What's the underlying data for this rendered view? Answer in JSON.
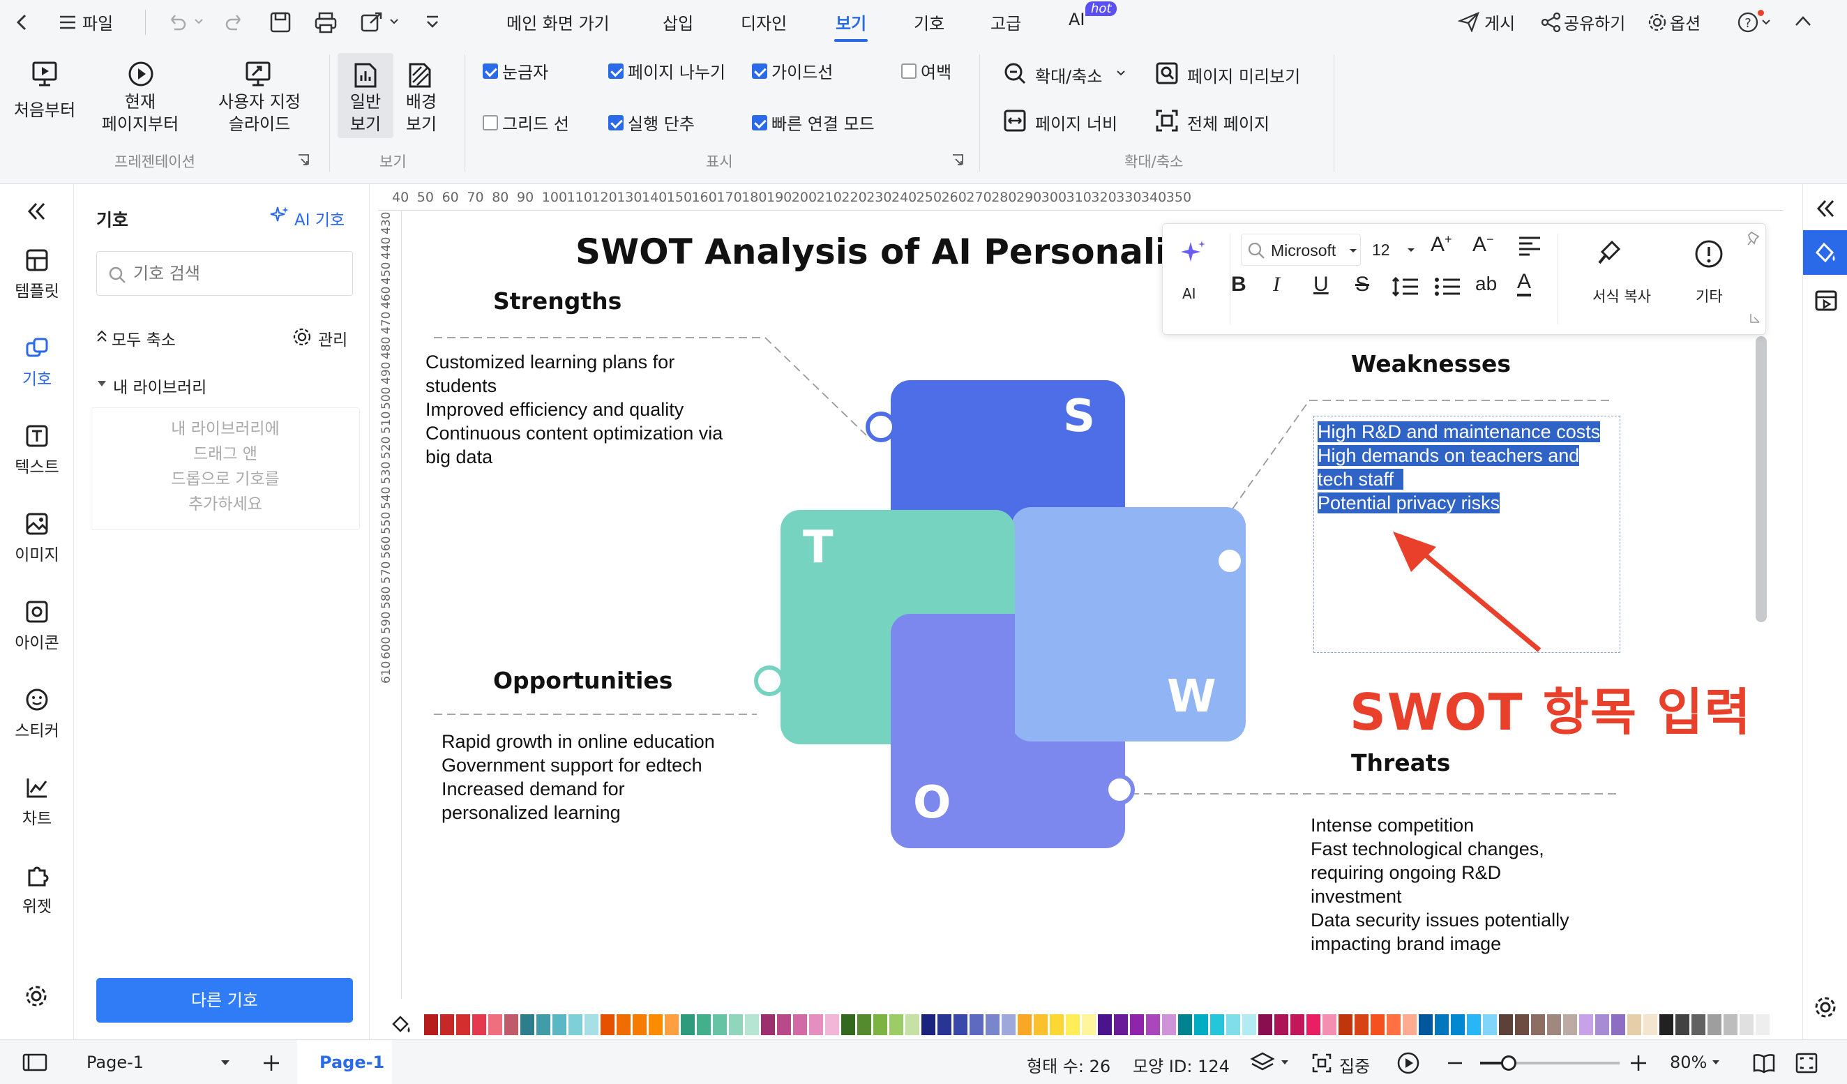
{
  "menubar": {
    "file": "파일",
    "tabs": [
      "메인 화면 가기",
      "삽입",
      "디자인",
      "보기",
      "기호",
      "고급",
      "AI"
    ],
    "active_tab": "보기",
    "ai_badge": "hot",
    "publish": "게시",
    "share": "공유하기",
    "options": "옵션"
  },
  "ribbon": {
    "presentation": {
      "from_start": "처음부터",
      "from_current_1": "현재",
      "from_current_2": "페이지부터",
      "custom_1": "사용자 지정",
      "custom_2": "슬라이드",
      "group_label": "프레젠테이션"
    },
    "view": {
      "normal_1": "일반",
      "normal_2": "보기",
      "background_1": "배경",
      "background_2": "보기",
      "group_label": "보기"
    },
    "display": {
      "ruler": "눈금자",
      "page_break": "페이지 나누기",
      "guides": "가이드선",
      "margin": "여백",
      "grid": "그리드 선",
      "undo": "실행 단추",
      "quick_connect": "빠른 연결 모드",
      "group_label": "표시"
    },
    "zoom": {
      "zoom": "확대/축소",
      "page_preview": "페이지 미리보기",
      "page_width": "페이지 너비",
      "whole_page": "전체 페이지",
      "group_label": "확대/축소"
    }
  },
  "rail": {
    "items": [
      "템플릿",
      "기호",
      "텍스트",
      "이미지",
      "아이콘",
      "스티커",
      "차트",
      "위젯"
    ]
  },
  "panel": {
    "title": "기호",
    "ai_symbols": "AI 기호",
    "search_placeholder": "기호 검색",
    "collapse_all": "모두 축소",
    "manage": "관리",
    "my_library": "내 라이브러리",
    "drop_hint_1": "내 라이브러리에",
    "drop_hint_2": "드래그 앤",
    "drop_hint_3": "드롭으로 기호를",
    "drop_hint_4": "추가하세요",
    "more_symbols": "다른 기호"
  },
  "ruler": {
    "top_ticks": [
      "40",
      "50",
      "60",
      "70",
      "80",
      "90",
      "100",
      "110",
      "120",
      "130",
      "140",
      "150",
      "160",
      "170",
      "180",
      "190",
      "200",
      "210",
      "220",
      "230",
      "240",
      "250",
      "260",
      "270",
      "280",
      "290",
      "300",
      "310",
      "320",
      "330",
      "340",
      "350"
    ],
    "left_ticks": [
      "430",
      "440",
      "450",
      "460",
      "470",
      "480",
      "490",
      "500",
      "510",
      "520",
      "530",
      "540",
      "550",
      "560",
      "570",
      "580",
      "590",
      "600",
      "610"
    ]
  },
  "float_toolbar": {
    "ai": "AI",
    "font": "Microsoft",
    "size": "12",
    "format_painter": "서식 복사",
    "more": "기타"
  },
  "diagram": {
    "title": "SWOT Analysis of AI Personalized",
    "letters": {
      "s": "S",
      "w": "W",
      "o": "O",
      "t": "T"
    },
    "strengths": {
      "heading": "Strengths",
      "lines": [
        "Customized learning plans for",
        "students",
        "Improved efficiency and quality",
        "Continuous content optimization via",
        "big data"
      ]
    },
    "weaknesses": {
      "heading": "Weaknesses",
      "lines": [
        "High R&D and maintenance costs",
        "High demands on teachers and",
        "tech staff",
        "Potential privacy risks"
      ]
    },
    "opportunities": {
      "heading": "Opportunities",
      "lines": [
        "Rapid growth in online education",
        "Government support for edtech",
        "Increased demand for",
        "personalized learning"
      ]
    },
    "threats": {
      "heading": "Threats",
      "lines": [
        "Intense competition",
        "Fast technological changes,",
        "requiring ongoing R&D",
        "investment",
        "Data security issues potentially",
        "impacting brand image"
      ]
    },
    "annotation": "SWOT 항목 입력"
  },
  "colors": {
    "accent": "#2a6ae8",
    "s_box": "#4e6ee8",
    "w_box": "#90b4f4",
    "o_box": "#7c88ee",
    "t_box": "#76d3c0",
    "annotation": "#e8402a",
    "selection": "#2f63c6"
  },
  "status": {
    "page_selector": "Page-1",
    "page_tab": "Page-1",
    "shape_count": "형태 수: 26",
    "shape_id": "모양 ID: 124",
    "focus": "집중",
    "zoom": "80%"
  }
}
